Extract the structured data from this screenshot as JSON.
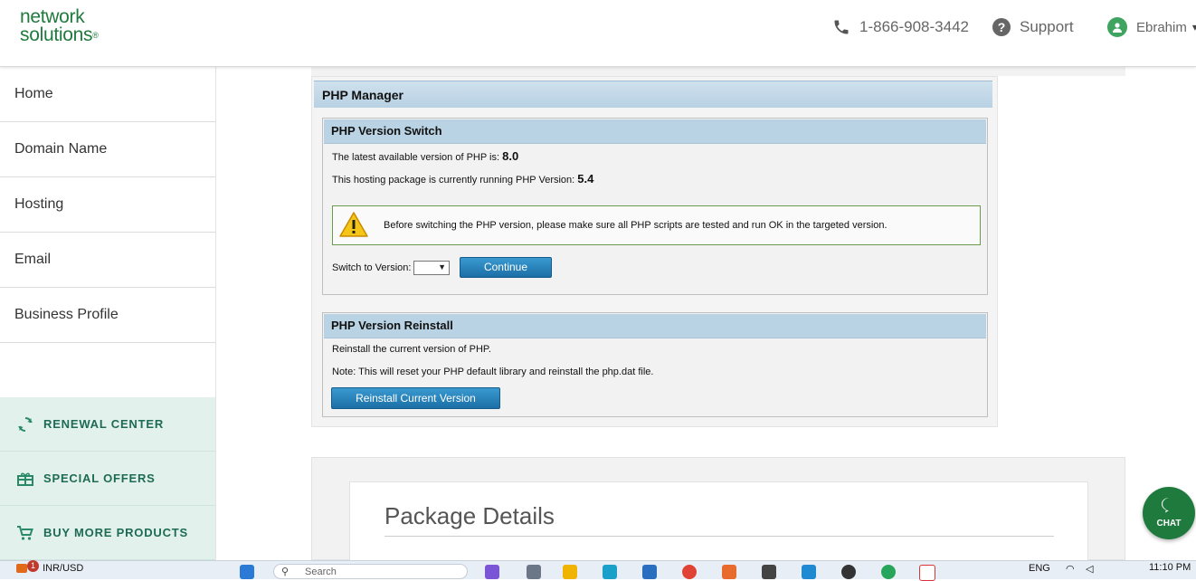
{
  "header": {
    "logo_line1": "network",
    "logo_line2": "solutions",
    "logo_mark": "®",
    "phone": "1-866-908-3442",
    "support": "Support",
    "user": "Ebrahim"
  },
  "sidebar": {
    "items": [
      {
        "label": "Home"
      },
      {
        "label": "Domain Name"
      },
      {
        "label": "Hosting"
      },
      {
        "label": "Email"
      },
      {
        "label": "Business Profile"
      }
    ],
    "links": [
      {
        "label": "RENEWAL CENTER",
        "icon": "refresh-icon"
      },
      {
        "label": "SPECIAL OFFERS",
        "icon": "gift-icon"
      },
      {
        "label": "BUY MORE PRODUCTS",
        "icon": "cart-icon"
      }
    ]
  },
  "php_manager": {
    "title": "PHP Manager",
    "switch": {
      "title": "PHP Version Switch",
      "latest_label": "The latest available version of PHP is:",
      "latest_value": "8.0",
      "current_label": "This hosting package is currently running PHP Version:",
      "current_value": "5.4",
      "warning": "Before switching the PHP version, please make sure all PHP scripts are tested and run OK in the targeted version.",
      "switch_label": "Switch to Version:",
      "selected_version": "",
      "continue_label": "Continue"
    },
    "reinstall": {
      "title": "PHP Version Reinstall",
      "line1": "Reinstall the current version of PHP.",
      "line2": "Note: This will reset your PHP default library and reinstall the php.dat file.",
      "button_label": "Reinstall Current Version"
    }
  },
  "package": {
    "title": "Package Details"
  },
  "chat": {
    "label": "CHAT"
  },
  "taskbar": {
    "currency": "INR/USD",
    "search_placeholder": "Search",
    "badge_count": "1",
    "lang": "ENG",
    "time": "11:10 PM"
  },
  "colors": {
    "brand_green": "#1f7a3d",
    "header_blue": "#b9d3e4",
    "button_blue": "#1b6fa6",
    "sidebar_green_bg": "#e3f1ed"
  }
}
